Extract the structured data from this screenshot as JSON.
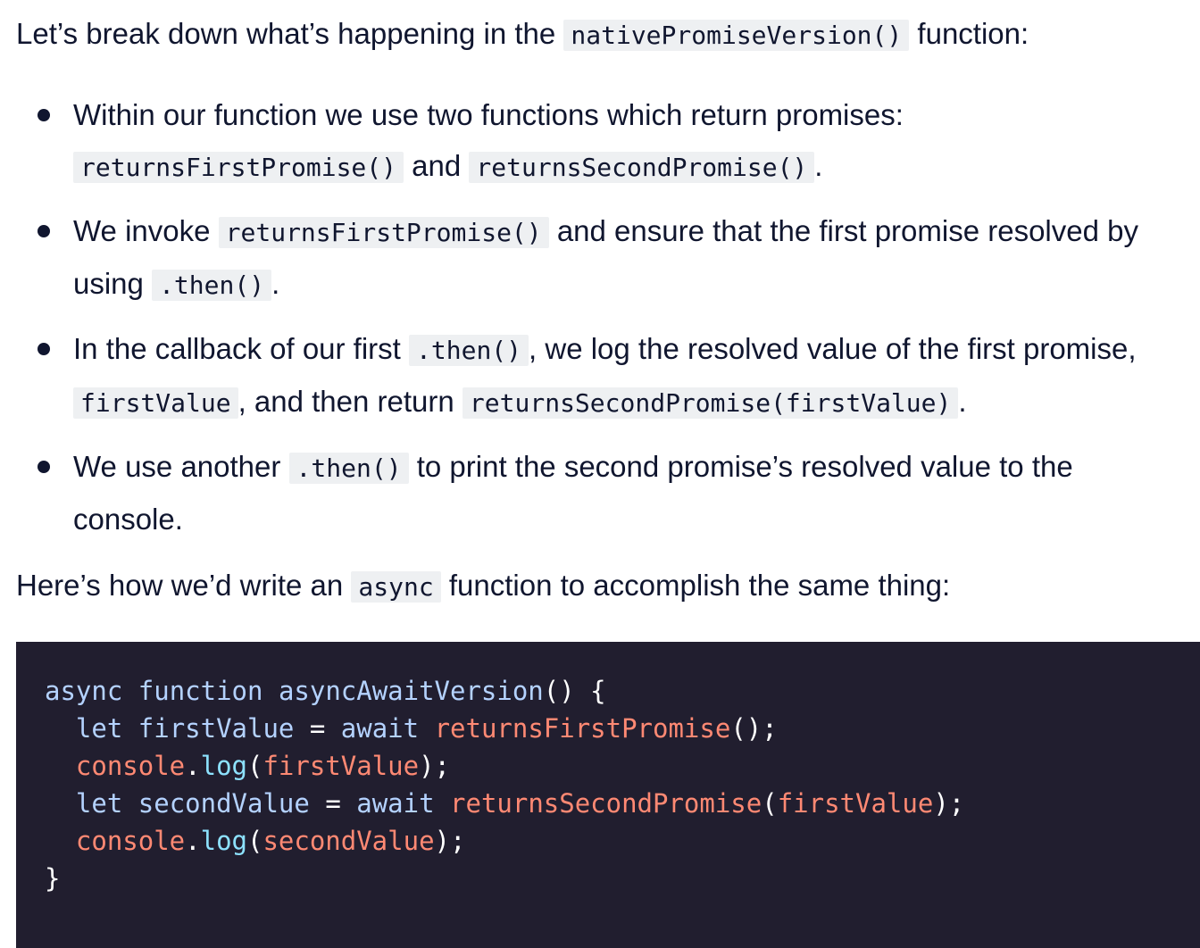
{
  "intro": {
    "before": "Let’s break down what’s happening in the ",
    "code": "nativePromiseVersion()",
    "after": " function:"
  },
  "bullets": [
    {
      "line1_text": "Within our function we use two functions which return promises:",
      "line2_code1": "returnsFirstPromise()",
      "line2_mid": " and ",
      "line2_code2": "returnsSecondPromise()",
      "line2_end": "."
    },
    {
      "line1_before": "We invoke ",
      "line1_code": "returnsFirstPromise()",
      "line1_after": " and ensure that the first promise resolved by",
      "line2_before": "using ",
      "line2_code": ".then()",
      "line2_end": "."
    },
    {
      "line1_before": "In the callback of our first ",
      "line1_code": ".then()",
      "line1_after": ", we log the resolved value of the first promise,",
      "line2_code1": "firstValue",
      "line2_mid": ", and then return ",
      "line2_code2": "returnsSecondPromise(firstValue)",
      "line2_end": "."
    },
    {
      "line1_before": "We use another ",
      "line1_code": ".then()",
      "line1_after": " to print the second promise’s resolved value to the",
      "line2_text": "console."
    }
  ],
  "outro": {
    "before": "Here’s how we’d write an ",
    "code": "async",
    "after": " function to accomplish the same thing:"
  },
  "code_block": {
    "l1_kw1": "async",
    "l1_kw2": "function",
    "l1_name": "asyncAwaitVersion",
    "l1_rest": "() {",
    "l2_kw": "let",
    "l2_var": "firstValue",
    "l2_op": "=",
    "l2_await": "await",
    "l2_call": "returnsFirstPromise",
    "l2_rest": "();",
    "l3_obj": "console",
    "l3_dot": ".",
    "l3_method": "log",
    "l3_open": "(",
    "l3_arg": "firstValue",
    "l3_close": ");",
    "l4_kw": "let",
    "l4_var": "secondValue",
    "l4_op": "=",
    "l4_await": "await",
    "l4_call": "returnsSecondPromise",
    "l4_open": "(",
    "l4_arg": "firstValue",
    "l4_close": ");",
    "l5_obj": "console",
    "l5_dot": ".",
    "l5_method": "log",
    "l5_open": "(",
    "l5_arg": "secondValue",
    "l5_close": ");",
    "l6": "}"
  }
}
